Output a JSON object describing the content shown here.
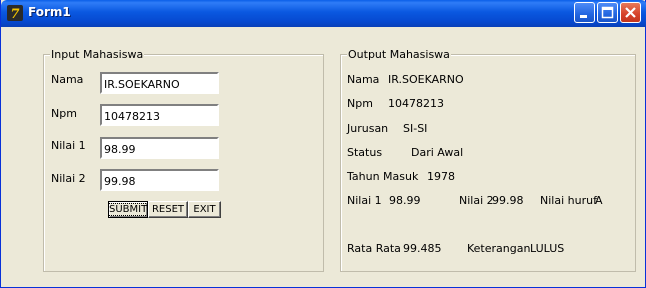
{
  "window": {
    "title": "Form1",
    "app_icon_label": "7"
  },
  "input_group": {
    "legend": "Input Mahasiswa",
    "fields": [
      {
        "label": "Nama",
        "value": "IR.SOEKARNO"
      },
      {
        "label": "Npm",
        "value": "10478213"
      },
      {
        "label": "Nilai 1",
        "value": "98.99"
      },
      {
        "label": "Nilai 2",
        "value": "99.98"
      }
    ],
    "buttons": {
      "submit": "SUBMIT",
      "reset": "RESET",
      "exit": "EXIT"
    }
  },
  "output_group": {
    "legend": "Output Mahasiswa",
    "nama": {
      "label": "Nama",
      "value": "IR.SOEKARNO"
    },
    "npm": {
      "label": "Npm",
      "value": "10478213"
    },
    "jurusan": {
      "label": "Jurusan",
      "value": "SI-SI"
    },
    "status": {
      "label": "Status",
      "value": "Dari Awal"
    },
    "tahun_masuk": {
      "label": "Tahun Masuk",
      "value": "1978"
    },
    "nilai1": {
      "label": "Nilai 1",
      "value": "98.99"
    },
    "nilai2": {
      "label": "Nilai 2",
      "value": "99.98"
    },
    "nilai_huruf": {
      "label": "Nilai huruf",
      "value": "A"
    },
    "rata_rata": {
      "label": "Rata Rata",
      "value": "99.485"
    },
    "keterangan": {
      "label": "Keterangan",
      "value": "LULUS"
    }
  }
}
